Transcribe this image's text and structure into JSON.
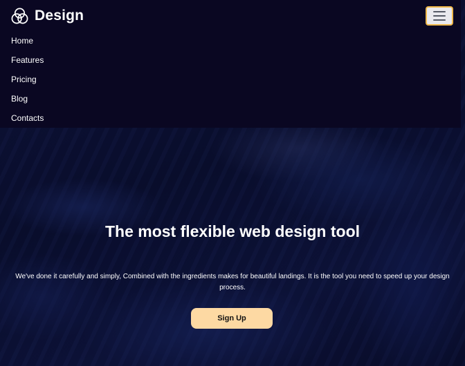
{
  "brand": {
    "name": "Design",
    "logo_icon": "three-circles-logo-icon"
  },
  "navbar": {
    "toggler_icon": "hamburger-menu-icon",
    "toggler_border_color": "#f0b84a",
    "background_color": "#0a0722",
    "items": [
      {
        "label": "Home"
      },
      {
        "label": "Features"
      },
      {
        "label": "Pricing"
      },
      {
        "label": "Blog"
      },
      {
        "label": "Contacts"
      }
    ]
  },
  "hero": {
    "title": "The most flexible web design tool",
    "text": "We've done it carefully and simply, Combined with the ingredients makes for beautiful landings. It is the tool you need to speed up your design process.",
    "cta_label": "Sign Up",
    "cta_color": "#fdd9a3"
  }
}
